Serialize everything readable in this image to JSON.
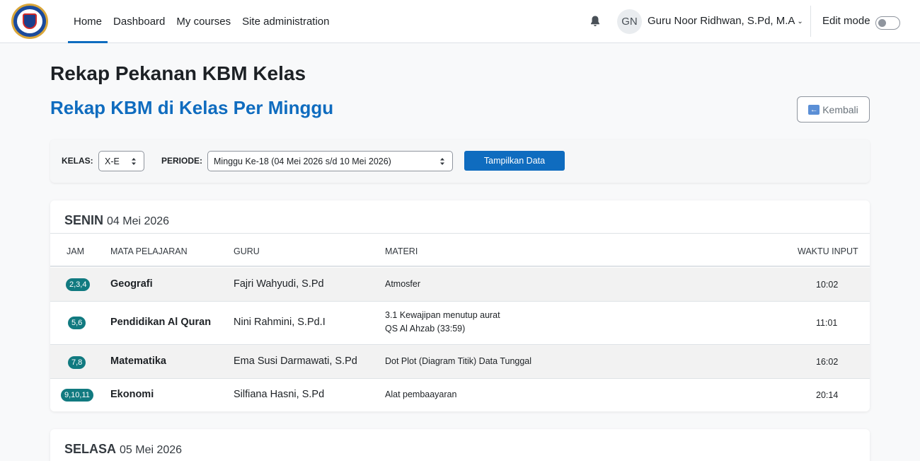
{
  "nav": {
    "links": [
      "Home",
      "Dashboard",
      "My courses",
      "Site administration"
    ],
    "avatar_initials": "GN",
    "user_name": "Guru Noor Ridhwan, S.Pd, M.A",
    "edit_mode_label": "Edit mode",
    "edit_mode_on": false
  },
  "header": {
    "title": "Rekap Pekanan KBM Kelas",
    "subtitle": "Rekap KBM di Kelas Per Minggu",
    "back_label": "Kembali"
  },
  "filter": {
    "kelas_label": "KELAS:",
    "kelas_value": "X-E",
    "periode_label": "PERIODE:",
    "periode_value": "Minggu Ke-18 (04 Mei 2026 s/d 10 Mei 2026)",
    "submit_label": "Tampilkan Data"
  },
  "columns": {
    "jam": "JAM",
    "mapel": "MATA PELAJARAN",
    "guru": "GURU",
    "materi": "MATERI",
    "waktu": "WAKTU INPUT"
  },
  "days": [
    {
      "name": "SENIN",
      "date": "04 Mei 2026",
      "rows": [
        {
          "jam": "2,3,4",
          "mapel": "Geografi",
          "guru": "Fajri Wahyudi, S.Pd",
          "materi": [
            "Atmosfer"
          ],
          "waktu": "10:02"
        },
        {
          "jam": "5,6",
          "mapel": "Pendidikan Al Quran",
          "guru": "Nini Rahmini, S.Pd.I",
          "materi": [
            "3.1 Kewajipan menutup aurat",
            "QS Al Ahzab (33:59)"
          ],
          "waktu": "11:01"
        },
        {
          "jam": "7,8",
          "mapel": "Matematika",
          "guru": "Ema Susi Darmawati, S.Pd",
          "materi": [
            "Dot Plot (Diagram Titik) Data Tunggal"
          ],
          "waktu": "16:02"
        },
        {
          "jam": "9,10,11",
          "mapel": "Ekonomi",
          "guru": "Silfiana Hasni, S.Pd",
          "materi": [
            "Alat pembaayaran"
          ],
          "waktu": "20:14"
        }
      ]
    },
    {
      "name": "SELASA",
      "date": "05 Mei 2026",
      "rows": []
    }
  ]
}
